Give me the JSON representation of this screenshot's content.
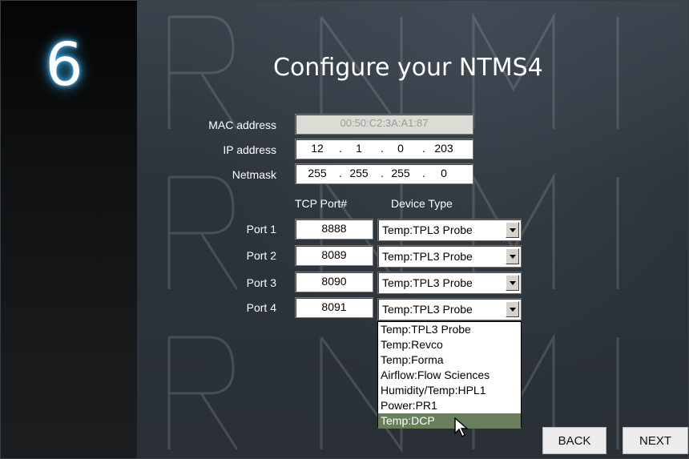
{
  "step_number": "6",
  "title": "Configure your NTMS4",
  "form": {
    "mac_label": "MAC address",
    "mac_value": "00:50:C2:3A:A1:87",
    "ip_label": "IP address",
    "ip_octets": [
      "12",
      "1",
      "0",
      "203"
    ],
    "netmask_label": "Netmask",
    "netmask_octets": [
      "255",
      "255",
      "255",
      "0"
    ]
  },
  "ports": {
    "tcp_header": "TCP Port#",
    "device_header": "Device Type",
    "rows": [
      {
        "label": "Port 1",
        "port": "8888",
        "device": "Temp:TPL3 Probe"
      },
      {
        "label": "Port 2",
        "port": "8089",
        "device": "Temp:TPL3 Probe"
      },
      {
        "label": "Port 3",
        "port": "8090",
        "device": "Temp:TPL3 Probe"
      },
      {
        "label": "Port 4",
        "port": "8091",
        "device": "Temp:TPL3 Probe"
      }
    ]
  },
  "dropdown": {
    "options": [
      "Temp:TPL3 Probe",
      "Temp:Revco",
      "Temp:Forma",
      "Airflow:Flow Sciences",
      "Humidity/Temp:HPL1",
      "Power:PR1",
      "Temp:DCP"
    ],
    "highlighted": "Temp:DCP"
  },
  "buttons": {
    "back": "BACK",
    "next": "NEXT"
  },
  "colors": {
    "glow": "#2f9bd8",
    "highlight": "#6a7d5c",
    "background": "#2d343c"
  }
}
